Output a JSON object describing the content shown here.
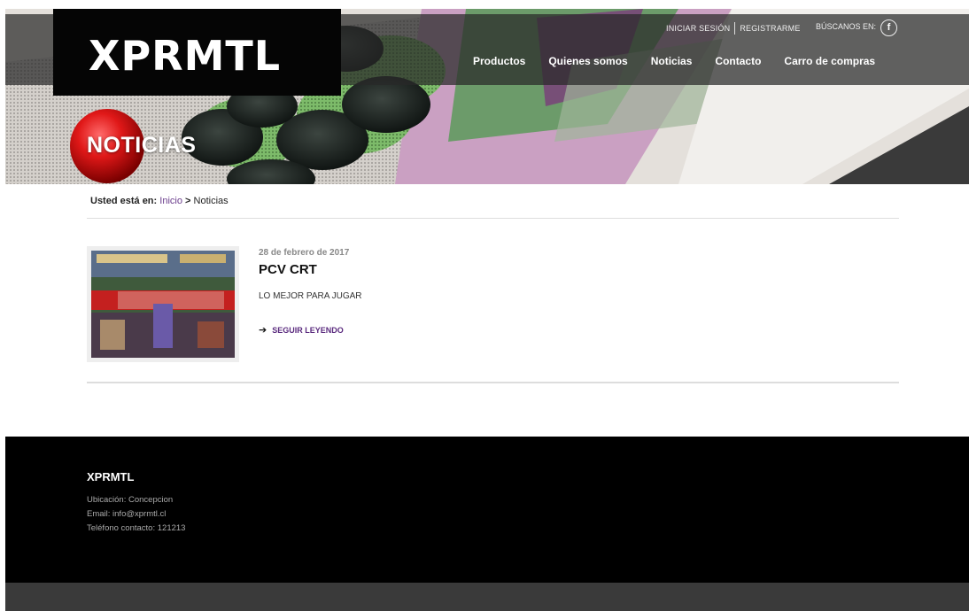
{
  "header": {
    "logo": "XPRMTL",
    "login": "INICIAR SESIÓN",
    "register": "REGISTRARME",
    "find_us": "BÚSCANOS EN:",
    "facebook_glyph": "f",
    "nav": [
      {
        "label": "Productos"
      },
      {
        "label": "Quienes somos"
      },
      {
        "label": "Noticias"
      },
      {
        "label": "Contacto"
      },
      {
        "label": "Carro de compras"
      }
    ]
  },
  "hero": {
    "title": "NOTICIAS"
  },
  "breadcrumb": {
    "label": "Usted está en:",
    "home": "Inicio",
    "separator": ">",
    "current": "Noticias"
  },
  "post": {
    "date": "28 de febrero de 2017",
    "title": "PCV CRT",
    "excerpt": "LO MEJOR PARA JUGAR",
    "read_more": "SEGUIR LEYENDO"
  },
  "footer": {
    "brand": "XPRMTL",
    "location": "Ubicación: Concepcion",
    "email": "Email: info@xprmtl.cl",
    "phone": "Teléfono contacto: 121213"
  },
  "colors": {
    "accent": "#6a3c8c",
    "footer_bg": "#000000",
    "bottombar_bg": "#3a3a3a"
  }
}
